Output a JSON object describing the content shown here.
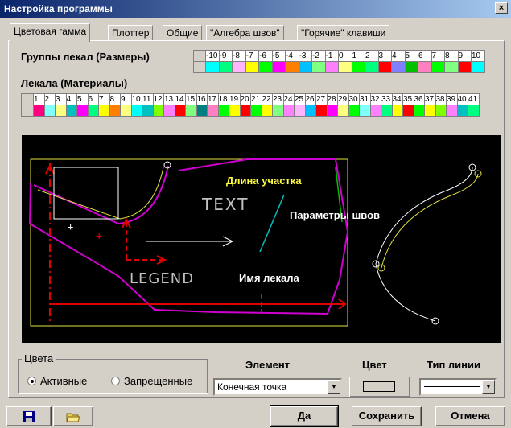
{
  "window": {
    "title": "Настройка программы",
    "close": "×"
  },
  "tabs": [
    {
      "label": "Цветовая гамма"
    },
    {
      "label": "Плоттер"
    },
    {
      "label": "Общие"
    },
    {
      "label": "\"Алгебра швов\""
    },
    {
      "label": "\"Горячие\" клавиши"
    }
  ],
  "size_groups": {
    "label": "Группы лекал (Размеры)",
    "headers": [
      "-10",
      "-9",
      "-8",
      "-7",
      "-6",
      "-5",
      "-4",
      "-3",
      "-2",
      "-1",
      "0",
      "1",
      "2",
      "3",
      "4",
      "5",
      "6",
      "7",
      "8",
      "9",
      "10"
    ],
    "colors": [
      "#00ffff",
      "#00ff80",
      "#ffb4ff",
      "#ffff00",
      "#00ff00",
      "#ff00ff",
      "#ff8000",
      "#00c0ff",
      "#80ff80",
      "#ff80ff",
      "#ffff80",
      "#00ff00",
      "#00ff80",
      "#ff0000",
      "#8080ff",
      "#00c000",
      "#ff80c0",
      "#00ff00",
      "#80ff80",
      "#ff0000",
      "#00ffff"
    ]
  },
  "materials": {
    "label": "Лекала (Материалы)",
    "headers": [
      "1",
      "2",
      "3",
      "4",
      "5",
      "6",
      "7",
      "8",
      "9",
      "10",
      "11",
      "12",
      "13",
      "14",
      "15",
      "16",
      "17",
      "18",
      "19",
      "20",
      "21",
      "22",
      "23",
      "24",
      "25",
      "26",
      "27",
      "28",
      "29",
      "30",
      "31",
      "32",
      "33",
      "34",
      "35",
      "36",
      "37",
      "38",
      "39",
      "40",
      "41"
    ],
    "colors": [
      "#ff0080",
      "#80ffff",
      "#ffff80",
      "#00c0c0",
      "#ff00ff",
      "#00ff80",
      "#ffff00",
      "#ff8000",
      "#ffff80",
      "#00ffff",
      "#00c0c0",
      "#80ff00",
      "#ff80ff",
      "#ff0000",
      "#80ff80",
      "#008080",
      "#ff80c0",
      "#00ff00",
      "#ffff00",
      "#ff0000",
      "#00ff00",
      "#ffff00",
      "#80ff80",
      "#ff80ff",
      "#ffb4ff",
      "#00c0ff",
      "#ff0000",
      "#ff00ff",
      "#ffff80",
      "#00ff00",
      "#80ffff",
      "#ff80ff",
      "#00ff80",
      "#ffff00",
      "#ff0000",
      "#00ff00",
      "#ffff00",
      "#80ff00",
      "#ff80ff",
      "#00c0c0",
      "#00ff80"
    ]
  },
  "preview": {
    "text_sample": "TEXT",
    "legend_sample": "LEGEND",
    "length_label": "Длина участка",
    "seam_params": "Параметры швов",
    "piece_name": "Имя лекала"
  },
  "colors_group": {
    "legend": "Цвета",
    "active": "Активные",
    "forbidden": "Запрещенные"
  },
  "labels": {
    "element": "Элемент",
    "color": "Цвет",
    "line_type": "Тип линии"
  },
  "element_select": {
    "value": "Конечная точка"
  },
  "buttons": {
    "ok": "Да",
    "save": "Сохранить",
    "cancel": "Отмена"
  },
  "icons": {
    "save": "floppy-disk-icon",
    "open": "folder-open-icon"
  }
}
